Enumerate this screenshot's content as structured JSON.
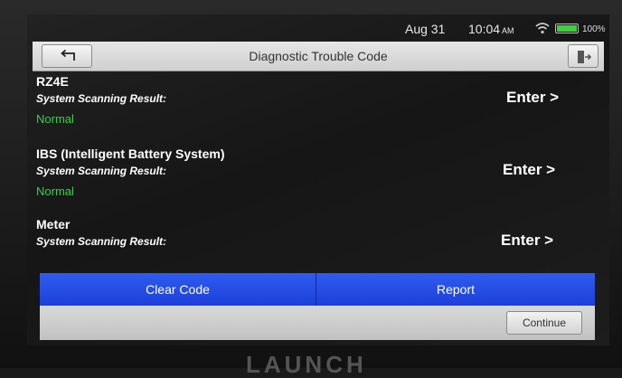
{
  "status_bar": {
    "date": "Aug 31",
    "time": "10:04",
    "ampm": "AM",
    "battery_percent": "100%"
  },
  "header": {
    "title": "Diagnostic Trouble Code",
    "back_icon": "back-arrow-icon",
    "exit_icon": "exit-icon"
  },
  "systems": [
    {
      "name": "RZ4E",
      "label": "System Scanning Result:",
      "status": "Normal",
      "action": "Enter >"
    },
    {
      "name": "IBS (Intelligent Battery System)",
      "label": "System Scanning Result:",
      "status": "Normal",
      "action": "Enter >"
    },
    {
      "name": "Meter",
      "label": "System Scanning Result:",
      "status": "",
      "action": "Enter >"
    }
  ],
  "actions": {
    "clear_code": "Clear Code",
    "report": "Report"
  },
  "footer": {
    "continue": "Continue"
  },
  "device": {
    "brand": "LAUNCH"
  },
  "colors": {
    "accent_blue": "#1d40d8",
    "status_green": "#35d24a",
    "screen_bg": "#1d1d1d"
  }
}
